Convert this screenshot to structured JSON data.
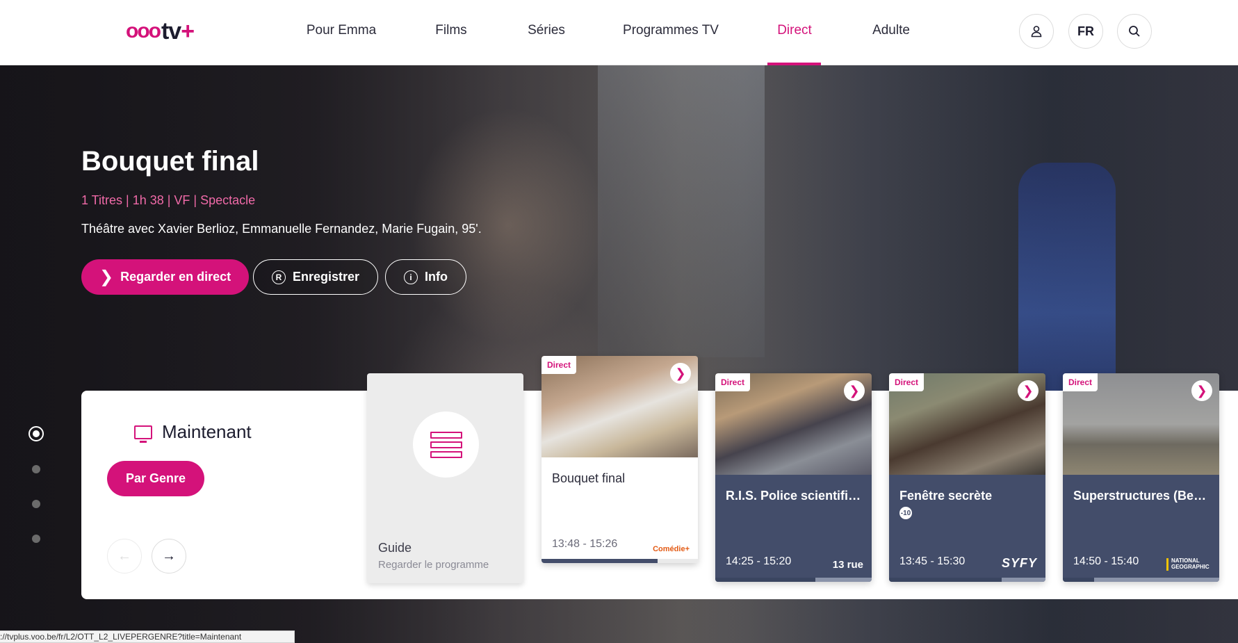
{
  "header": {
    "logo": {
      "voo": "ooo",
      "tv": "tv",
      "plus": "+"
    },
    "nav": [
      {
        "label": "Pour Emma"
      },
      {
        "label": "Films"
      },
      {
        "label": "Séries"
      },
      {
        "label": "Programmes TV"
      },
      {
        "label": "Direct",
        "active": true
      },
      {
        "label": "Adulte"
      }
    ],
    "lang": "FR",
    "icons": {
      "user": "user-icon",
      "search": "search-icon"
    }
  },
  "hero": {
    "title": "Bouquet final",
    "meta": "1 Titres | 1h 38 | VF | Spectacle",
    "description": "Théâtre avec Xavier Berlioz, Emmanuelle Fernandez, Marie Fugain, 95'.",
    "buttons": {
      "watch": "Regarder en direct",
      "record": "Enregistrer",
      "info": "Info"
    }
  },
  "panel": {
    "title": "Maintenant",
    "genre_button": "Par Genre"
  },
  "guide": {
    "title": "Guide",
    "subtitle": "Regarder le programme"
  },
  "cards": [
    {
      "tag": "Direct",
      "title": "Bouquet final",
      "time": "13:48 - 15:26",
      "channel": "Comédie+",
      "progress": 0.74
    },
    {
      "tag": "Direct",
      "title": "R.I.S. Police scientifiqu...",
      "time": "14:25 - 15:20",
      "channel": "13 rue",
      "progress": 0.64
    },
    {
      "tag": "Direct",
      "title": "Fenêtre secrète",
      "rating": "-10",
      "time": "13:45 - 15:30",
      "channel": "SYFY",
      "progress": 0.72
    },
    {
      "tag": "Direct",
      "title": "Superstructures (Belug...",
      "time": "14:50 - 15:40",
      "channel": "NATIONAL GEOGRAPHIC",
      "progress": 0.2
    }
  ],
  "statusbar": "://tvplus.voo.be/fr/L2/OTT_L2_LIVEPERGENRE?title=Maintenant",
  "colors": {
    "accent": "#d4127a",
    "card_body": "#434d6a"
  }
}
